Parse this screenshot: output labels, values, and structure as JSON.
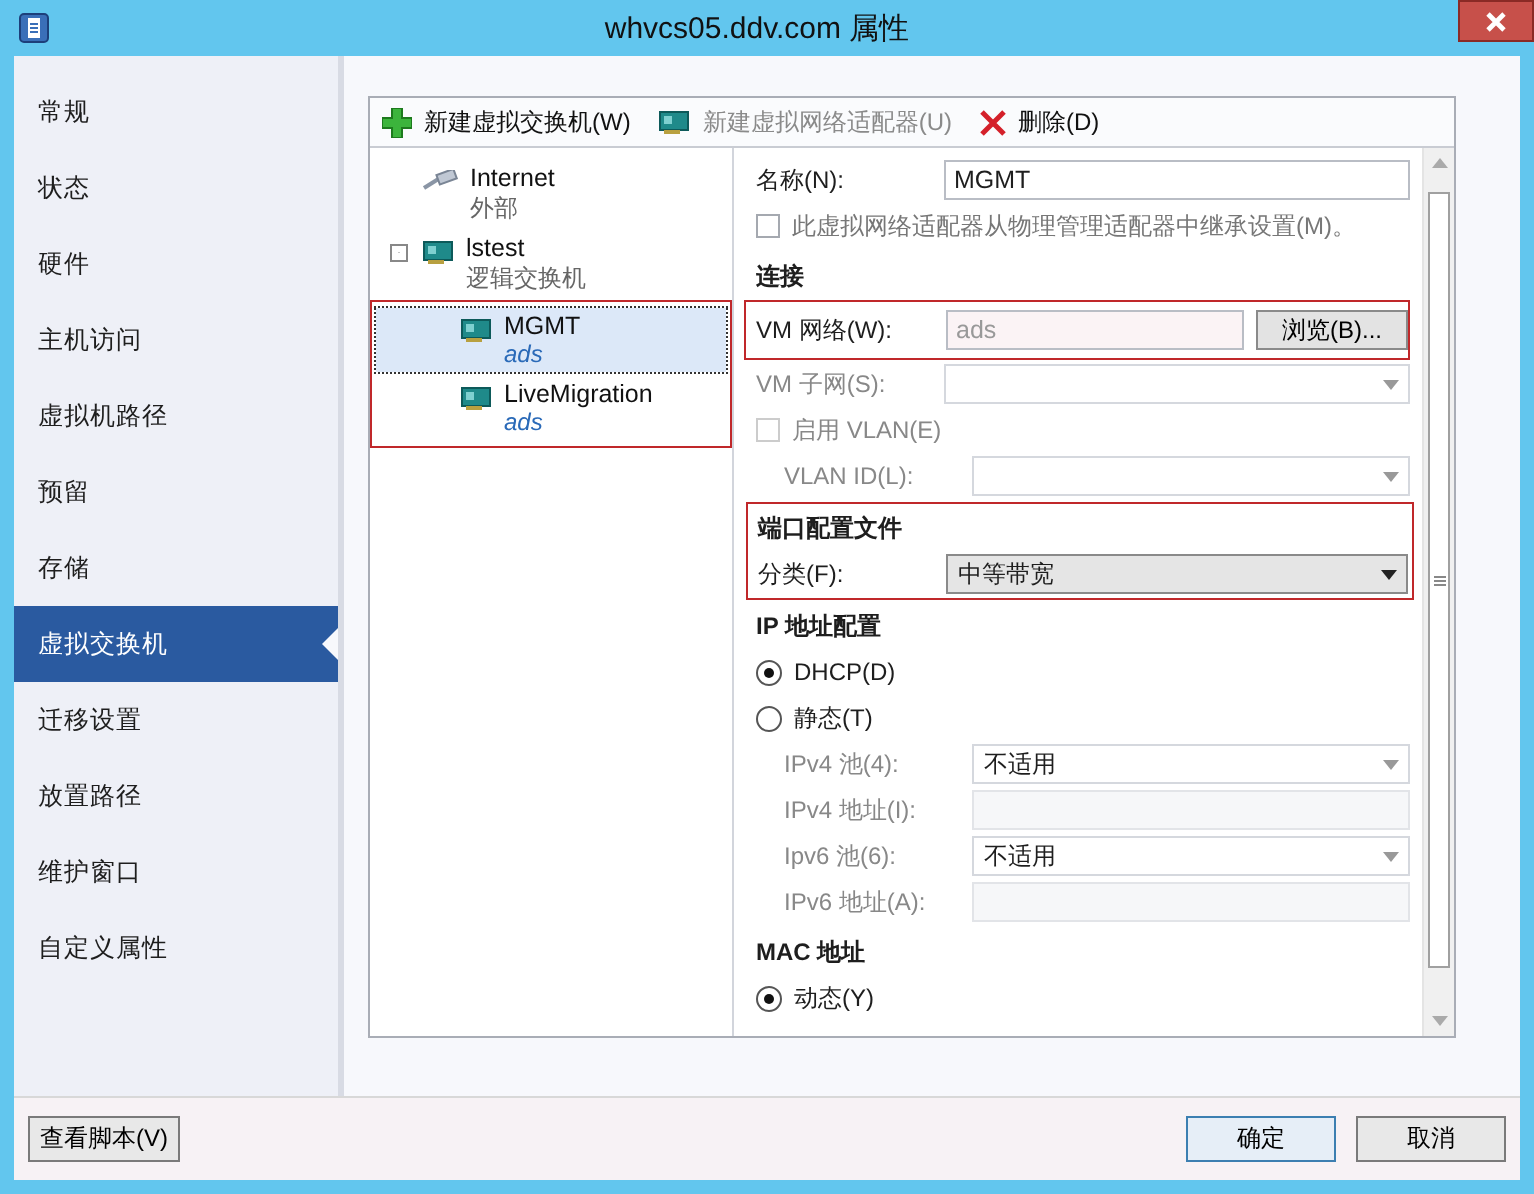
{
  "window": {
    "title": "whvcs05.ddv.com 属性"
  },
  "sidebar": {
    "items": [
      {
        "label": "常规",
        "selected": false
      },
      {
        "label": "状态",
        "selected": false
      },
      {
        "label": "硬件",
        "selected": false
      },
      {
        "label": "主机访问",
        "selected": false
      },
      {
        "label": "虚拟机路径",
        "selected": false
      },
      {
        "label": "预留",
        "selected": false
      },
      {
        "label": "存储",
        "selected": false
      },
      {
        "label": "虚拟交换机",
        "selected": true
      },
      {
        "label": "迁移设置",
        "selected": false
      },
      {
        "label": "放置路径",
        "selected": false
      },
      {
        "label": "维护窗口",
        "selected": false
      },
      {
        "label": "自定义属性",
        "selected": false
      }
    ]
  },
  "toolbar": [
    {
      "label": "新建虚拟交换机(W)",
      "kind": "add",
      "disabled": false
    },
    {
      "label": "新建虚拟网络适配器(U)",
      "kind": "adapter",
      "disabled": true
    },
    {
      "label": "删除(D)",
      "kind": "delete",
      "disabled": false
    }
  ],
  "tree": [
    {
      "name": "Internet",
      "subtitle": "外部",
      "kind": "external"
    },
    {
      "name": "lstest",
      "subtitle": "逻辑交换机",
      "kind": "logical",
      "expanded": true,
      "children_highlighted": true,
      "children": [
        {
          "name": "MGMT",
          "subtitle": "ads",
          "kind": "adapter",
          "selected": true
        },
        {
          "name": "LiveMigration",
          "subtitle": "ads",
          "kind": "adapter",
          "selected": false
        }
      ]
    }
  ],
  "form": [
    {
      "rows": [
        {
          "kind": "field",
          "label": "名称(N):",
          "value": "MGMT",
          "disabled": false
        },
        {
          "kind": "checkbox",
          "label": "此虚拟网络适配器从物理管理适配器中继承设置(M)。",
          "checked": false,
          "disabled": false
        }
      ]
    },
    {
      "heading": "连接",
      "highlighted": false,
      "rows": [
        {
          "kind": "browse",
          "label": "VM 网络(W):",
          "value": "ads",
          "button": "浏览(B)...",
          "highlighted": true
        },
        {
          "kind": "dropdown",
          "label": "VM 子网(S):",
          "disabled": true
        },
        {
          "kind": "checkbox",
          "label": "启用 VLAN(E)",
          "checked": false,
          "disabled": true,
          "children": [
            {
              "kind": "dropdown",
              "label": "VLAN ID(L):",
              "disabled": true
            }
          ]
        }
      ]
    },
    {
      "heading": "端口配置文件",
      "highlighted": true,
      "rows": [
        {
          "kind": "dropdown",
          "label": "分类(F):",
          "value": "中等带宽",
          "disabled": false
        }
      ]
    },
    {
      "heading": "IP 地址配置",
      "highlighted": false,
      "rows": [
        {
          "kind": "radio",
          "label": "DHCP(D)",
          "selected": true
        },
        {
          "kind": "radio",
          "label": "静态(T)",
          "selected": false,
          "children": [
            {
              "kind": "dropdown",
              "label": "IPv4 池(4):",
              "value": "不适用",
              "disabled": true
            },
            {
              "kind": "field",
              "label": "IPv4 地址(I):",
              "disabled": true
            },
            {
              "kind": "dropdown",
              "label": "Ipv6 池(6):",
              "value": "不适用",
              "disabled": true
            },
            {
              "kind": "field",
              "label": "IPv6 地址(A):",
              "disabled": true
            }
          ]
        }
      ]
    },
    {
      "heading": "MAC 地址",
      "highlighted": false,
      "rows": [
        {
          "kind": "radio",
          "label": "动态(Y)",
          "selected": true
        }
      ]
    }
  ],
  "footer": {
    "script_button": "查看脚本(V)",
    "buttons": [
      {
        "label": "确定",
        "selected": true
      },
      {
        "label": "取消",
        "selected": false
      }
    ]
  }
}
